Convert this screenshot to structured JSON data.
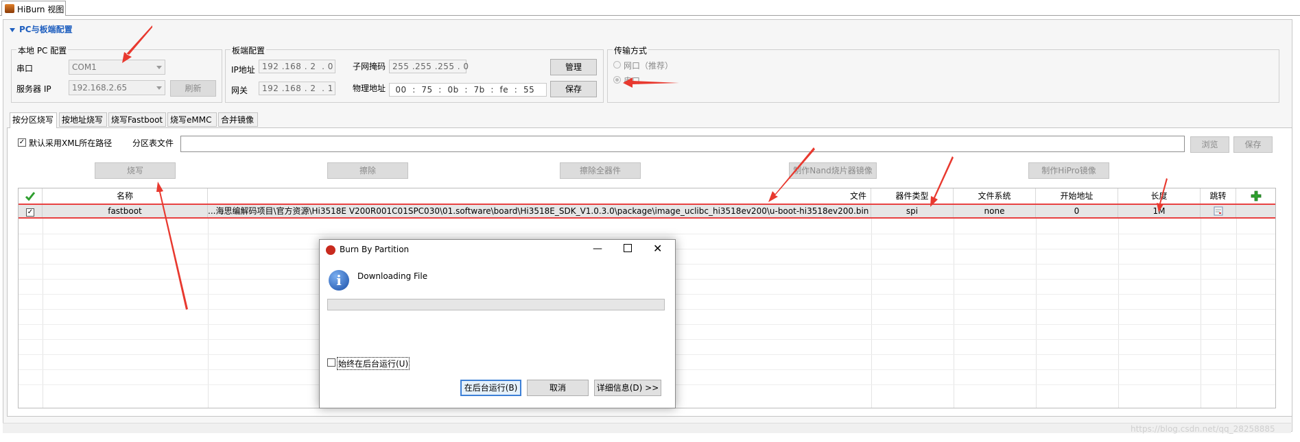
{
  "window": {
    "tab_title": "HiBurn 视图"
  },
  "section": {
    "title": "PC与板端配置"
  },
  "local_pc": {
    "group_label": "本地 PC 配置",
    "serial_label": "串口",
    "serial_value": "COM1",
    "server_ip_label": "服务器 IP",
    "server_ip_value": "192.168.2.65",
    "refresh_label": "刷新"
  },
  "board": {
    "group_label": "板端配置",
    "ip_label": "IP地址",
    "ip_value": "192 .168 . 2  . 0",
    "subnet_label": "子网掩码",
    "subnet_value": "255 .255 .255 . 0",
    "gateway_label": "网关",
    "gateway_value": "192 .168 . 2  . 1",
    "mac_label": "物理地址",
    "mac_value": " 00  :  75  :  0b  :  7b  :  fe  :  55",
    "manage_label": "管理",
    "save_label": "保存"
  },
  "transfer": {
    "group_label": "传输方式",
    "option_network": "网口（推荐）",
    "option_serial": "串口",
    "selected": "串口"
  },
  "tabs": [
    {
      "label": "按分区烧写",
      "active": true
    },
    {
      "label": "按地址烧写",
      "active": false
    },
    {
      "label": "烧写Fastboot",
      "active": false
    },
    {
      "label": "烧写eMMC",
      "active": false
    },
    {
      "label": "合并镜像",
      "active": false
    }
  ],
  "partition": {
    "use_xml_path_label": "默认采用XML所在路径",
    "partition_file_label": "分区表文件",
    "partition_file_value": "",
    "browse_label": "浏览",
    "save_label": "保存",
    "burn_label": "烧写",
    "erase_label": "擦除",
    "erase_all_label": "擦除全器件",
    "make_nand_label": "制作Nand烧片器镜像",
    "make_hipro_label": "制作HiPro镜像"
  },
  "table": {
    "headers": [
      "名称",
      "文件",
      "器件类型",
      "文件系统",
      "开始地址",
      "长度",
      "跳转"
    ],
    "rows": [
      {
        "checked": true,
        "name": "fastboot",
        "file": "...海思编解码项目\\官方资源\\Hi3518E V200R001C01SPC030\\01.software\\board\\Hi3518E_SDK_V1.0.3.0\\package\\image_uclibc_hi3518ev200\\u-boot-hi3518ev200.bin",
        "device_type": "spi",
        "file_system": "none",
        "start_address": "0",
        "length": "1M"
      }
    ]
  },
  "dialog": {
    "title": "Burn By Partition",
    "message": "Downloading File",
    "progress": 0,
    "always_background_label": "始终在后台运行(U)",
    "run_background_label": "在后台运行(B)",
    "cancel_label": "取消",
    "details_label": "详细信息(D) >>"
  },
  "watermark": "https://blog.csdn.net/qq_28258885",
  "colors": {
    "section_title": "#1f5fbf",
    "annotation_arrow": "#e8392f",
    "row_highlight": "#e84040"
  }
}
